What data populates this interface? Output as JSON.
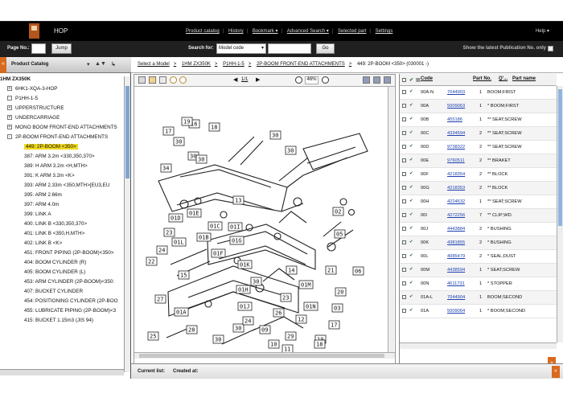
{
  "app": {
    "title": "HOP"
  },
  "topnav": [
    {
      "label": "Product catalog"
    },
    {
      "label": "History"
    },
    {
      "label": "Bookmark ▾"
    },
    {
      "label": "Advanced Search ▾"
    },
    {
      "label": "Selected part"
    },
    {
      "label": "Settings"
    }
  ],
  "help": "Help ▾",
  "search": {
    "page_label": "Page No.:",
    "page_value": "",
    "jump_label": "Jump",
    "search_for_label": "Search for:",
    "mode_value": "Model code",
    "query_value": "",
    "go_label": "Go",
    "latest_label": "Show the latest Publication No. only"
  },
  "left": {
    "catalog_title": "Product Catalog",
    "tree": [
      {
        "level": 0,
        "label": "1HM ZX350K",
        "bold": true
      },
      {
        "level": 1,
        "label": "6HK1-XQA-3-HOP",
        "expand": "+"
      },
      {
        "level": 1,
        "label": "P1HH-1-5",
        "expand": "−"
      },
      {
        "level": 2,
        "label": "UPPERSTRUCTURE",
        "expand": "+"
      },
      {
        "level": 2,
        "label": "UNDERCARRIAGE",
        "expand": "+"
      },
      {
        "level": 2,
        "label": "MONO BOOM FRONT-END ATTACHMENTS",
        "expand": "+"
      },
      {
        "level": 2,
        "label": "2P-BOOM FRONT-END ATTACHMENTS",
        "expand": "−"
      },
      {
        "level": 3,
        "label": "449: 2P-BOOM <350>",
        "selected": true
      },
      {
        "level": 3,
        "label": "387: ARM 3.2m <330,350,370>"
      },
      {
        "level": 3,
        "label": "389: H ARM 3.2m <H,MTH>"
      },
      {
        "level": 3,
        "label": "391: K ARM 3.2m <K>"
      },
      {
        "level": 3,
        "label": "393: ARM 2.33m <350,MTH>[EU3,EU"
      },
      {
        "level": 3,
        "label": "395: ARM 2.66m"
      },
      {
        "level": 3,
        "label": "397: ARM 4.0m"
      },
      {
        "level": 3,
        "label": "399: LINK A"
      },
      {
        "level": 3,
        "label": "400: LINK B <330,350,370>"
      },
      {
        "level": 3,
        "label": "401: LINK B <350,H,MTH>"
      },
      {
        "level": 3,
        "label": "402: LINK B <K>"
      },
      {
        "level": 3,
        "label": "451: FRONT PIPING (2P-BOOM)<350>"
      },
      {
        "level": 3,
        "label": "404: BOOM CYLINDER (R)"
      },
      {
        "level": 3,
        "label": "405: BOOM CYLINDER (L)"
      },
      {
        "level": 3,
        "label": "453: ARM CYLINDER (2P-BOOM)<350:"
      },
      {
        "level": 3,
        "label": "407: BUCKET CYLINDER"
      },
      {
        "level": 3,
        "label": "454: POSITIONING CYLINDER (2P-BOO"
      },
      {
        "level": 3,
        "label": "455: LUBRICATE PIPING (2P-BOOM)<3"
      },
      {
        "level": 3,
        "label": "415: BUCKET 1.15m3 (JIS 94)"
      }
    ]
  },
  "breadcrumb": {
    "items": [
      "Select a Model",
      "1HM ZX350K",
      "P1HH-1-5",
      "2P-BOOM FRONT-END ATTACHMENTS"
    ],
    "last": "449: 2P-BOOM <350> (030001 -)"
  },
  "drawing": {
    "page": "1/1",
    "zoom": "46%",
    "callouts": [
      "30",
      "16",
      "18",
      "34",
      "30",
      "30",
      "17",
      "19",
      "30",
      "30",
      "23",
      "01E",
      "01B",
      "01D",
      "01L",
      "24",
      "01C",
      "01F",
      "01I",
      "22",
      "15",
      "01K",
      "01H",
      "01G",
      "02",
      "05",
      "01A",
      "01J",
      "27",
      "30",
      "23",
      "26",
      "19",
      "29",
      "12",
      "14",
      "21",
      "20",
      "01M",
      "03",
      "06",
      "01N",
      "17",
      "18",
      "09",
      "10",
      "11",
      "30",
      "25",
      "28",
      "30",
      "24",
      "13"
    ]
  },
  "parts": {
    "headers": {
      "code": "Code",
      "part_no": "Part No.",
      "qty": "Q'...",
      "part_name": "Part name"
    },
    "rows": [
      {
        "code": "00A-N",
        "part": "7044903",
        "qty": "1",
        "name": "BOOM;FIRST"
      },
      {
        "code": "00A",
        "part": "5009063",
        "qty": "1",
        "name": "* BOOM;FIRST"
      },
      {
        "code": "00B",
        "part": "455186",
        "qty": "1",
        "name": "** SEAT;SCREW"
      },
      {
        "code": "00C",
        "part": "4334594",
        "qty": "2",
        "name": "** SEAT;SCREW"
      },
      {
        "code": "00D",
        "part": "9738322",
        "qty": "2",
        "name": "** SEAT;SCREW"
      },
      {
        "code": "00E",
        "part": "9760511",
        "qty": "2",
        "name": "** BRAKET"
      },
      {
        "code": "00F",
        "part": "4218354",
        "qty": "2",
        "name": "** BLOCK"
      },
      {
        "code": "00G",
        "part": "4218353",
        "qty": "2",
        "name": "** BLOCK"
      },
      {
        "code": "00H",
        "part": "4224632",
        "qty": "1",
        "name": "** SEAT;SCREW"
      },
      {
        "code": "00I",
        "part": "4272256",
        "qty": "7",
        "name": "** CLIP;WD."
      },
      {
        "code": "00J",
        "part": "4443884",
        "qty": "2",
        "name": "* BUSHING"
      },
      {
        "code": "00K",
        "part": "4381855",
        "qty": "2",
        "name": "* BUSHING"
      },
      {
        "code": "00L",
        "part": "4085479",
        "qty": "2",
        "name": "* SEAL;DUST"
      },
      {
        "code": "00M",
        "part": "4438594",
        "qty": "1",
        "name": "* SEAT;SCREW"
      },
      {
        "code": "00N",
        "part": "4611731",
        "qty": "1",
        "name": "* STOPPER"
      },
      {
        "code": "01A-L",
        "part": "7044904",
        "qty": "1",
        "name": "BOOM;SECOND"
      },
      {
        "code": "01A",
        "part": "5009064",
        "qty": "1",
        "name": "* BOOM;SECOND"
      }
    ]
  },
  "bottom": {
    "current_list": "Current list:",
    "created_at": "Created at:"
  },
  "colors": {
    "accent": "#d86a1f",
    "selected": "#f1d81e",
    "link": "#1b3fb0"
  }
}
